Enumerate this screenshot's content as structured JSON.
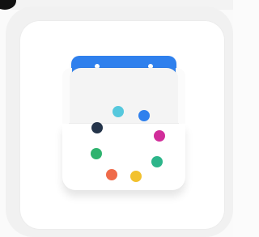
{
  "app_icon": {
    "dots": [
      {
        "name": "dot-navy",
        "color": "#24344a"
      },
      {
        "name": "dot-cyan",
        "color": "#56c8dd"
      },
      {
        "name": "dot-blue",
        "color": "#2f80ed"
      },
      {
        "name": "dot-magenta",
        "color": "#d12d9a"
      },
      {
        "name": "dot-green-right",
        "color": "#2db58a"
      },
      {
        "name": "dot-yellow",
        "color": "#f2c12e"
      },
      {
        "name": "dot-orange",
        "color": "#ef6b4a"
      },
      {
        "name": "dot-green-left",
        "color": "#2fb36f"
      }
    ],
    "binder_color": "#2f80ed",
    "icon_name": "calendar-icon"
  }
}
